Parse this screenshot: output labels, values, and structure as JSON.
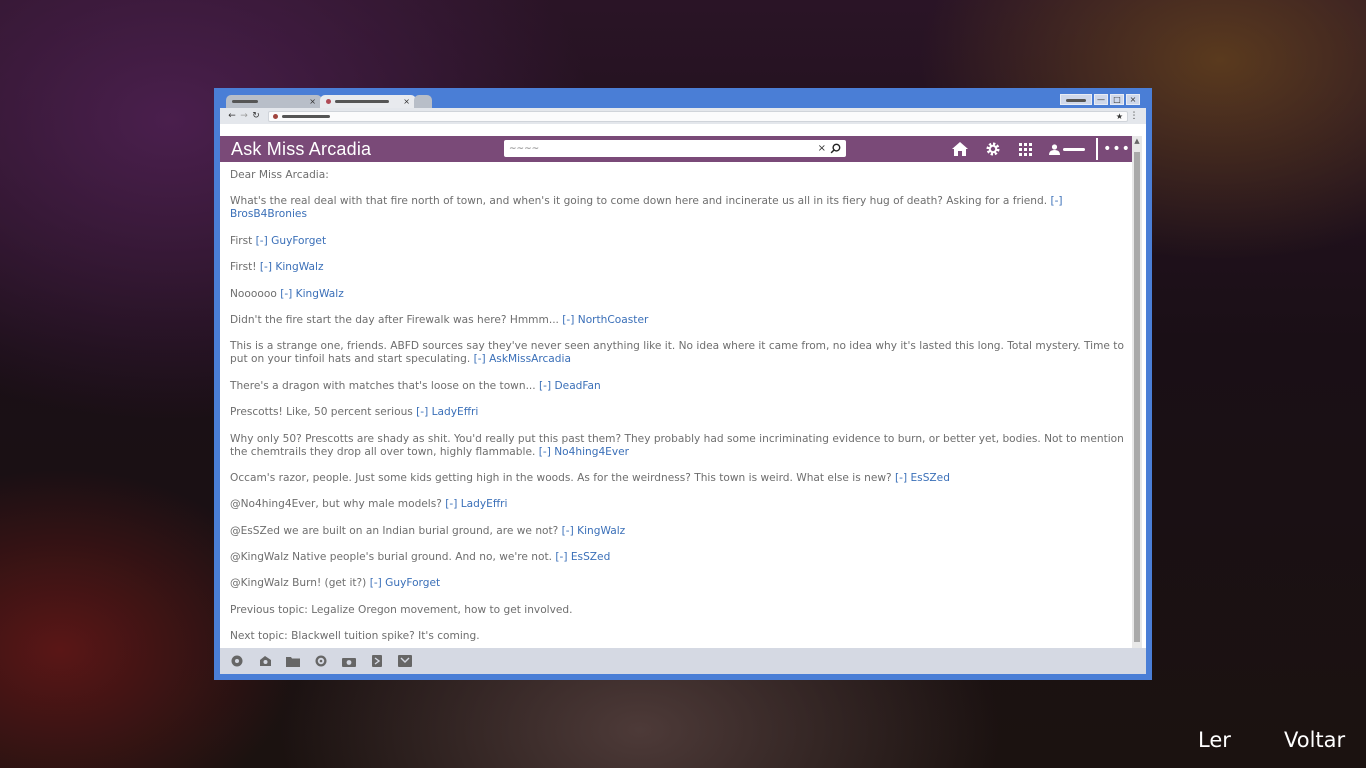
{
  "site": {
    "title": "Ask Miss Arcadia",
    "search_value": "",
    "search_placeholder": "~~~~",
    "header_color": "#7a4a78",
    "link_color": "#3a6fb8"
  },
  "browser": {
    "tab_close": "×",
    "forward_label": "→",
    "back_label": "←",
    "reload_label": "↻",
    "star_label": "★",
    "menu_label": "⋮",
    "minimize": "—",
    "maximize": "□",
    "close": "×",
    "frame_color": "#4a7ed6"
  },
  "posts": [
    {
      "text": "Dear Miss Arcadia:",
      "link": "",
      "author": ""
    },
    {
      "text": "What's the real deal with that fire north of town, and when's it going to come down here and incinerate us all in its fiery hug of death? Asking for a friend. ",
      "link": "[-] ",
      "author": "BrosB4Bronies"
    },
    {
      "text": "First ",
      "link": "[-] ",
      "author": "GuyForget"
    },
    {
      "text": "First! ",
      "link": "[-] ",
      "author": "KingWalz"
    },
    {
      "text": "Noooooo ",
      "link": "[-] ",
      "author": "KingWalz"
    },
    {
      "text": "Didn't the fire start the day after Firewalk was here? Hmmm... ",
      "link": "[-] ",
      "author": "NorthCoaster"
    },
    {
      "text": "This is a strange one, friends. ABFD sources say they've never seen anything like it. No idea where it came from, no idea why it's lasted this long. Total mystery. Time to put on your tinfoil hats and start speculating. ",
      "link": "[-] ",
      "author": "AskMissArcadia"
    },
    {
      "text": "There's a dragon with matches that's loose on the town... ",
      "link": "[-] ",
      "author": "DeadFan"
    },
    {
      "text": "Prescotts! Like, 50 percent serious ",
      "link": "[-] ",
      "author": "LadyEffri"
    },
    {
      "text": "Why only 50? Prescotts are shady as shit. You'd really put this past them? They probably had some incriminating evidence to burn, or better yet, bodies. Not to mention the chemtrails they drop all over town, highly flammable. ",
      "link": "[-] ",
      "author": "No4hing4Ever"
    },
    {
      "text": "Occam's razor, people. Just some kids getting high in the woods. As for the weirdness? This town is weird. What else is new? ",
      "link": "[-] ",
      "author": "EsSZed"
    },
    {
      "text": "@No4hing4Ever, but why male models? ",
      "link": "[-] ",
      "author": "LadyEffri"
    },
    {
      "text": "@EsSZed we are built on an Indian burial ground, are we not? ",
      "link": "[-] ",
      "author": "KingWalz"
    },
    {
      "text": "@KingWalz Native people's burial ground. And no, we're not. ",
      "link": "[-] ",
      "author": "EsSZed"
    },
    {
      "text": "@KingWalz Burn! (get it?) ",
      "link": "[-] ",
      "author": "GuyForget"
    },
    {
      "text": "Previous topic: Legalize Oregon movement, how to get involved.",
      "link": "",
      "author": ""
    },
    {
      "text": "Next topic: Blackwell tuition spike? It's coming.",
      "link": "",
      "author": ""
    }
  ],
  "game_ui": {
    "read_label": "Ler",
    "back_label": "Voltar"
  }
}
